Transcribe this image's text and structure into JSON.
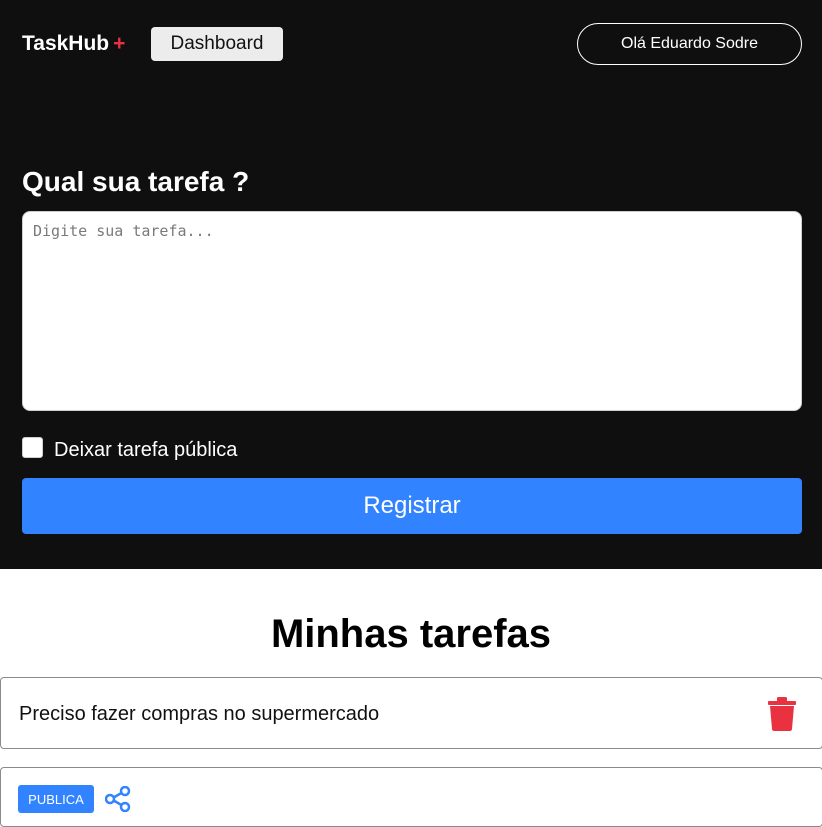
{
  "header": {
    "logo_text": "TaskHub",
    "logo_plus": "+",
    "dashboard_label": "Dashboard",
    "user_greeting": "Olá Eduardo Sodre"
  },
  "form": {
    "title": "Qual sua tarefa ?",
    "textarea_value": "",
    "textarea_placeholder": "Digite sua tarefa...",
    "public_checkbox_label": "Deixar tarefa pública",
    "public_checkbox_checked": false,
    "submit_label": "Registrar"
  },
  "tasks": {
    "title": "Minhas tarefas",
    "items": [
      {
        "text": "Preciso fazer compras no supermercado",
        "icon": "trash-icon"
      },
      {
        "badge": "PUBLICA",
        "icon": "share-icon"
      }
    ]
  },
  "colors": {
    "header_bg": "#0f0f0f",
    "accent_blue": "#3183ff",
    "accent_red": "#ea3140"
  }
}
